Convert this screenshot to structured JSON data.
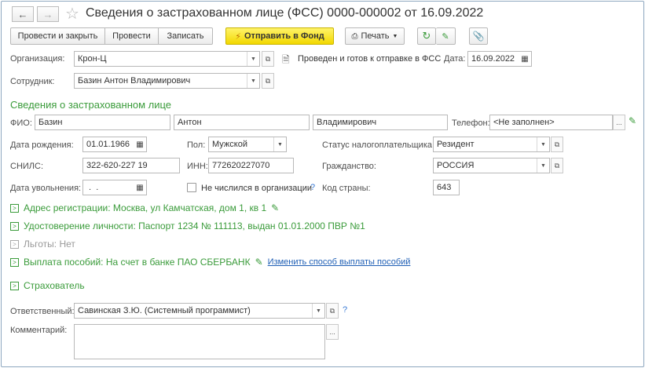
{
  "title": "Сведения о застрахованном лице (ФСС) 0000-000002 от 16.09.2022",
  "toolbar": {
    "post_close": "Провести и закрыть",
    "post": "Провести",
    "save": "Записать",
    "send": "Отправить в Фонд",
    "print": "Печать"
  },
  "org": {
    "label": "Организация:",
    "value": "Крон-Ц"
  },
  "status": "Проведен и готов к отправке в ФСС",
  "date": {
    "label": "Дата:",
    "value": "16.09.2022"
  },
  "employee": {
    "label": "Сотрудник:",
    "value": "Базин Антон Владимирович"
  },
  "section_title": "Сведения о застрахованном лице",
  "fio": {
    "label": "ФИО:",
    "last": "Базин",
    "first": "Антон",
    "middle": "Владимирович"
  },
  "phone": {
    "label": "Телефон:",
    "value": "<Не заполнен>"
  },
  "birth": {
    "label": "Дата рождения:",
    "value": "01.01.1966"
  },
  "sex": {
    "label": "Пол:",
    "value": "Мужской"
  },
  "tax_status": {
    "label": "Статус налогоплательщика:",
    "value": "Резидент"
  },
  "snils": {
    "label": "СНИЛС:",
    "value": "322-620-227 19"
  },
  "inn": {
    "label": "ИНН:",
    "value": "772620227070"
  },
  "citizenship": {
    "label": "Гражданство:",
    "value": "РОССИЯ"
  },
  "dismissal": {
    "label": "Дата увольнения:",
    "value": " .  ."
  },
  "not_listed": "Не числился в организации",
  "country_code": {
    "label": "Код страны:",
    "value": "643"
  },
  "address": "Адрес регистрации: Москва, ул Камчатская, дом 1, кв 1",
  "identity": "Удостоверение личности: Паспорт 1234 № 111113, выдан 01.01.2000 ПВР №1",
  "benefits": "Льготы: Нет",
  "payment": "Выплата пособий: На счет в банке ПАО СБЕРБАНК",
  "payment_link": "Изменить способ выплаты пособий",
  "insurer": "Страхователь",
  "responsible": {
    "label": "Ответственный:",
    "value": "Савинская З.Ю. (Системный программист)"
  },
  "comment": {
    "label": "Комментарий:",
    "value": ""
  },
  "misc": {
    "question": "?",
    "ellipsis": "..."
  },
  "colors": {
    "green": "#3a9b3a",
    "send_yellow": "#f2d800",
    "link": "#1f5fb5"
  }
}
